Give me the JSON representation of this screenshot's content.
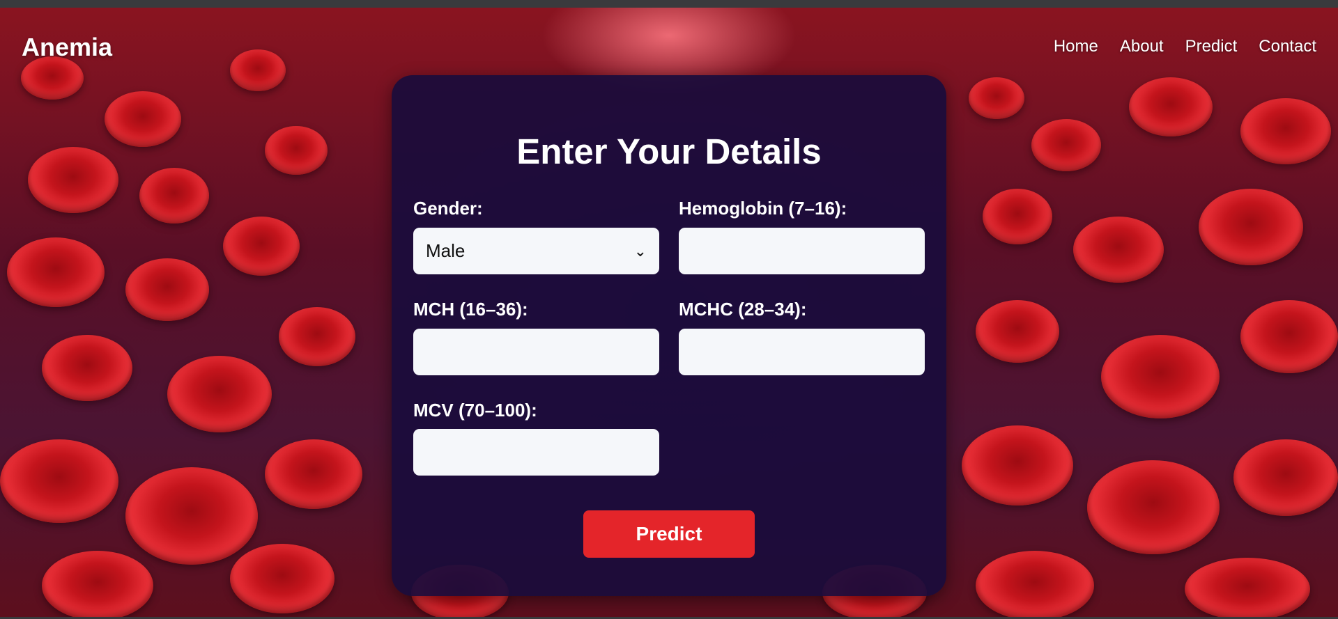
{
  "nav": {
    "brand": "Anemia",
    "items": [
      {
        "label": "Home"
      },
      {
        "label": "About"
      },
      {
        "label": "Predict"
      },
      {
        "label": "Contact"
      }
    ]
  },
  "form": {
    "title": "Enter Your Details",
    "gender": {
      "label": "Gender:",
      "value": "Male"
    },
    "hemoglobin": {
      "label": "Hemoglobin (7–16):",
      "value": ""
    },
    "mch": {
      "label": "MCH (16–36):",
      "value": ""
    },
    "mchc": {
      "label": "MCHC (28–34):",
      "value": ""
    },
    "mcv": {
      "label": "MCV (70–100):",
      "value": ""
    },
    "submit_label": "Predict"
  },
  "colors": {
    "card": "#190c3c",
    "button": "#e4252a",
    "input_bg": "#f5f7fa"
  }
}
